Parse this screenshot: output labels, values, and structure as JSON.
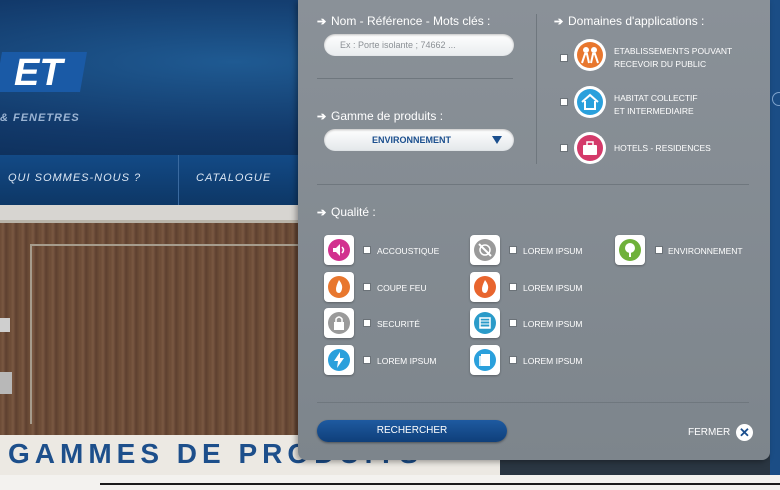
{
  "site": {
    "logo_text": "ET",
    "logo_subtitle": "& FENETRES",
    "nav": [
      {
        "label": "QUI SOMMES-NOUS ?"
      },
      {
        "label": "CATALOGUE"
      }
    ],
    "gammes_title": "GAMMES DE PRODUITS"
  },
  "search": {
    "keyword_title": "Nom - Référence - Mots clés :",
    "keyword_placeholder": "Ex : Porte isolante ; 74662 ...",
    "gamme_title": "Gamme de produits :",
    "gamme_selected": "ENVIRONNEMENT",
    "domaines_title": "Domaines d'applications :",
    "domaines": [
      {
        "label_line1": "ETABLISSEMENTS POUVANT",
        "label_line2": "RECEVOIR DU PUBLIC",
        "icon": "people-icon",
        "color": "#e8772e"
      },
      {
        "label_line1": "HABITAT COLLECTIF",
        "label_line2": "ET INTERMEDIAIRE",
        "icon": "house-icon",
        "color": "#2aa0dc"
      },
      {
        "label_line1": "HOTELS - RESIDENCES",
        "label_line2": "",
        "icon": "suitcase-icon",
        "color": "#d43a6a"
      }
    ],
    "qualite_title": "Qualité :",
    "qualites": [
      {
        "label": "ACCOUSTIQUE",
        "icon": "sound-icon",
        "color": "#d2318f"
      },
      {
        "label": "LOREM IPSUM",
        "icon": "cross-circle-icon",
        "color": "#9a9a9a"
      },
      {
        "label": "ENVIRONNEMENT",
        "icon": "tree-icon",
        "color": "#6fb13a"
      },
      {
        "label": "COUPE FEU",
        "icon": "fire-icon",
        "color": "#e8772e"
      },
      {
        "label": "LOREM IPSUM",
        "icon": "fire-icon",
        "color": "#e8652e"
      },
      {
        "label": "SECURITÉ",
        "icon": "lock-icon",
        "color": "#9a9a9a"
      },
      {
        "label": "LOREM IPSUM",
        "icon": "grid-icon",
        "color": "#2a9bc9"
      },
      {
        "label": "LOREM IPSUM",
        "icon": "lightning-icon",
        "color": "#2aa0dc"
      },
      {
        "label": "LOREM IPSUM",
        "icon": "panel-icon",
        "color": "#2aa0dc"
      }
    ],
    "submit_label": "RECHERCHER",
    "close_label": "FERMER"
  },
  "colors": {
    "brand_blue": "#12396a",
    "panel_gray": "#838a91",
    "button_blue": "#1a4f8e"
  }
}
